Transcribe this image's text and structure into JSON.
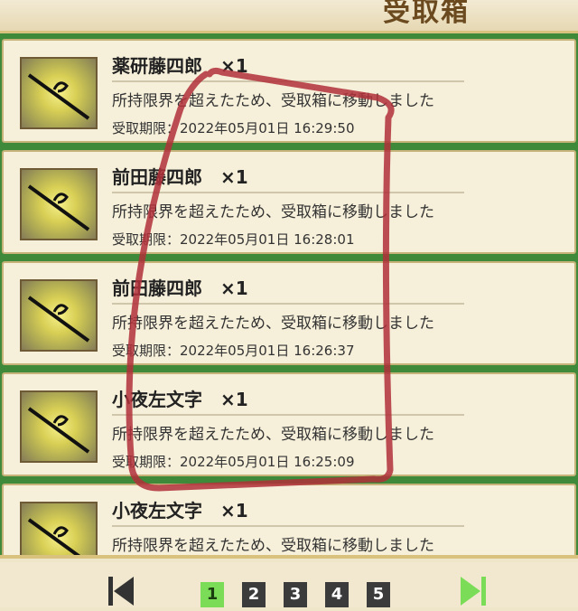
{
  "header": {
    "title": "受取箱"
  },
  "items": [
    {
      "name": "薬研藤四郎　×1",
      "message": "所持限界を超えたため、受取箱に移動しました",
      "deadline": "受取期限：2022年05月01日 16:29:50"
    },
    {
      "name": "前田藤四郎　×1",
      "message": "所持限界を超えたため、受取箱に移動しました",
      "deadline": "受取期限：2022年05月01日 16:28:01"
    },
    {
      "name": "前田藤四郎　×1",
      "message": "所持限界を超えたため、受取箱に移動しました",
      "deadline": "受取期限：2022年05月01日 16:26:37"
    },
    {
      "name": "小夜左文字　×1",
      "message": "所持限界を超えたため、受取箱に移動しました",
      "deadline": "受取期限：2022年05月01日 16:25:09"
    },
    {
      "name": "小夜左文字　×1",
      "message": "所持限界を超えたため、受取箱に移動しました",
      "deadline": ""
    }
  ],
  "pagination": {
    "pages": [
      "1",
      "2",
      "3",
      "4",
      "5"
    ],
    "current": "1"
  },
  "colors": {
    "frame": "#3f8a3a",
    "annotation": "#b0303a",
    "active_page": "#7bdc58"
  }
}
